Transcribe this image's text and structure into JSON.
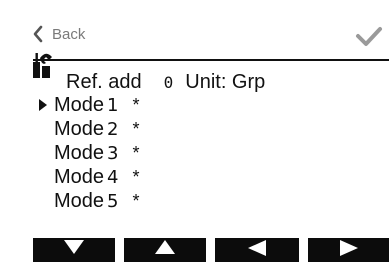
{
  "topbar": {
    "back_label": "Back",
    "back_icon": "chevron-left-icon",
    "confirm_icon": "check-icon",
    "text_color": "#7a7a7a"
  },
  "header": {
    "tool_icon": "wrench-screwdriver-icon",
    "ref_label": "Ref. add",
    "ref_value": "0",
    "unit_label": "Unit: Grp"
  },
  "modes": [
    {
      "label": "Mode",
      "index": "1",
      "mark": "*",
      "selected": true
    },
    {
      "label": "Mode",
      "index": "2",
      "mark": "*",
      "selected": false
    },
    {
      "label": "Mode",
      "index": "3",
      "mark": "*",
      "selected": false
    },
    {
      "label": "Mode",
      "index": "4",
      "mark": "*",
      "selected": false
    },
    {
      "label": "Mode",
      "index": "5",
      "mark": "*",
      "selected": false
    }
  ],
  "softkeys": [
    {
      "icon": "arrow-down-icon"
    },
    {
      "icon": "arrow-up-icon"
    },
    {
      "icon": "arrow-left-icon"
    },
    {
      "icon": "arrow-right-icon"
    }
  ],
  "colors": {
    "foreground": "#111111",
    "softkey_bg": "#0c0c0c",
    "softkey_fg": "#ffffff"
  }
}
